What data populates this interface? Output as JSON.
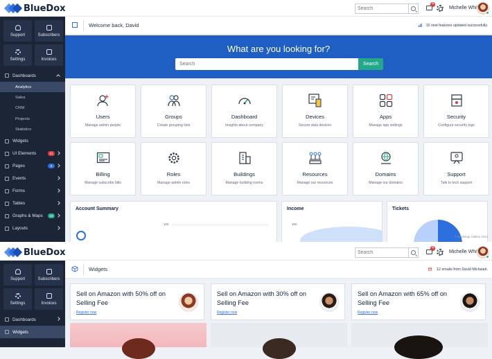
{
  "brand": {
    "name": "BlueDox"
  },
  "topbar": {
    "search_placeholder": "Search",
    "mail_badge": "4",
    "user_name": "Michelle White"
  },
  "sidebar": {
    "tiles": [
      {
        "label": "Support",
        "icon": "headset-icon"
      },
      {
        "label": "Subscribers",
        "icon": "subscribers-icon"
      },
      {
        "label": "Settings",
        "icon": "gear-icon"
      },
      {
        "label": "Invoices",
        "icon": "chart-icon"
      }
    ],
    "nav": [
      {
        "label": "Dashboards",
        "expanded": true,
        "children": [
          "Analytics",
          "Sales",
          "CRM",
          "Projects",
          "Statistics"
        ],
        "active_child": "Analytics"
      },
      {
        "label": "Widgets"
      },
      {
        "label": "UI Elements",
        "badge": "21",
        "badge_color": "#e53a3a"
      },
      {
        "label": "Pages",
        "badge": "8",
        "badge_color": "#2e6fe0"
      },
      {
        "label": "Events"
      },
      {
        "label": "Forms"
      },
      {
        "label": "Tables"
      },
      {
        "label": "Graphs & Maps",
        "badge": "15",
        "badge_color": "#23a88a"
      },
      {
        "label": "Layouts"
      }
    ]
  },
  "screen1": {
    "page_title": "Welcome back, David",
    "note": "15 new features updated successfully.",
    "hero_title": "What are you looking for?",
    "hero_search_placeholder": "Search",
    "hero_search_button": "Search",
    "cards": [
      {
        "title": "Users",
        "sub": "Manage admin people",
        "icon": "user-add-icon"
      },
      {
        "title": "Groups",
        "sub": "Create grouping lists",
        "icon": "group-icon"
      },
      {
        "title": "Dashboard",
        "sub": "Insights about company",
        "icon": "speedometer-icon"
      },
      {
        "title": "Devices",
        "sub": "Secure data devices",
        "icon": "devices-icon"
      },
      {
        "title": "Apps",
        "sub": "Manage app settings",
        "icon": "apps-grid-icon"
      },
      {
        "title": "Security",
        "sub": "Configure security logs",
        "icon": "security-icon"
      },
      {
        "title": "Billing",
        "sub": "Manage subscribe bills",
        "icon": "billing-icon"
      },
      {
        "title": "Roles",
        "sub": "Manage admin roles",
        "icon": "gear-icon"
      },
      {
        "title": "Buildings",
        "sub": "Manage building rooms",
        "icon": "building-icon"
      },
      {
        "title": "Resources",
        "sub": "Manage our resources",
        "icon": "resources-icon"
      },
      {
        "title": "Domains",
        "sub": "Manage our domains",
        "icon": "domain-icon"
      },
      {
        "title": "Support",
        "sub": "Talk to tech support",
        "icon": "support-chat-icon"
      }
    ],
    "panels": [
      {
        "title": "Account Summary",
        "axis_tick": "100"
      },
      {
        "title": "Income",
        "axis_tick": "460"
      },
      {
        "title": "Tickets"
      }
    ],
    "footnote": "© Bootstrap Gallery 2024"
  },
  "screen2": {
    "page_title": "Widgets",
    "note": "12 emails from David Michaiah.",
    "active_nav": "Widgets",
    "promos": [
      {
        "line1": "Sell on Amazon with 50% off on",
        "line2": "Selling Fee",
        "link": "Register now"
      },
      {
        "line1": "Sell on Amazon with 30% off on",
        "line2": "Selling Fee",
        "link": "Register now"
      },
      {
        "line1": "Sell on Amazon with 65% off on",
        "line2": "Selling Fee",
        "link": "Register now"
      }
    ]
  },
  "colors": {
    "accent": "#1f5fc4",
    "sidebar": "#1b2535",
    "success": "#23a88a",
    "danger": "#e53a3a"
  }
}
